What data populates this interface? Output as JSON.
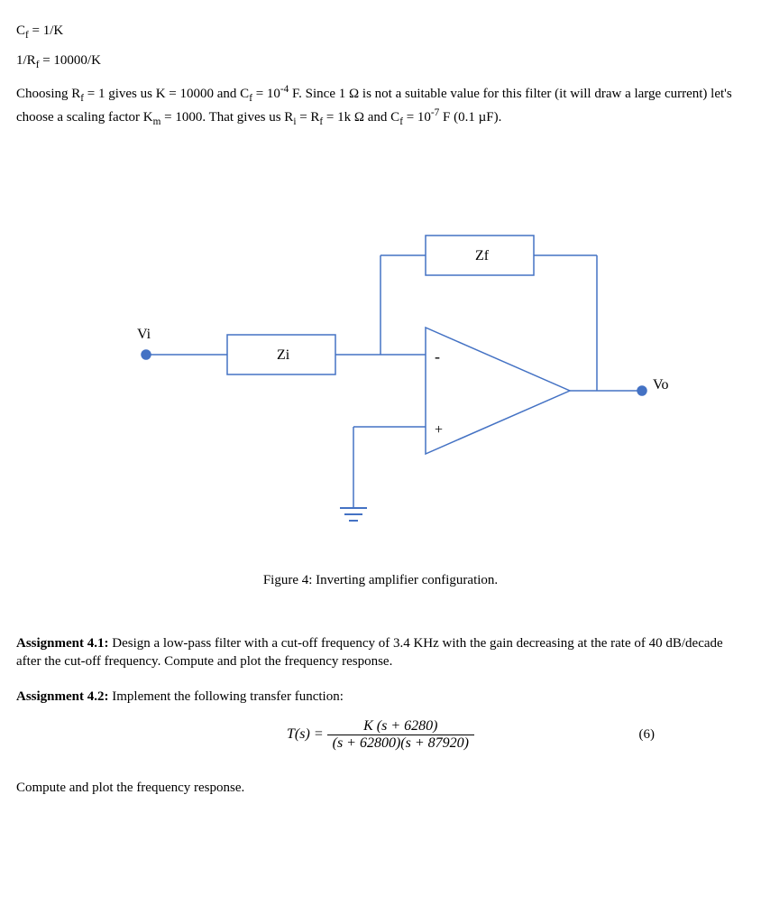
{
  "line1": "Cf = 1/K",
  "line2": "1/Rf = 10000/K",
  "para1": "Choosing Rf = 1 gives us K = 10000 and Cf = 10⁻⁴ F. Since 1 Ω is not a suitable value for this filter (it will draw a large current) let's choose a scaling factor Km = 1000. That gives us Ri = Rf = 1k Ω and Cf = 10⁻⁷ F (0.1 μF).",
  "diagram": {
    "vi": "Vi",
    "zi": "Zi",
    "zf": "Zf",
    "vo": "Vo",
    "minus": "-",
    "plus": "+"
  },
  "caption": "Figure 4: Inverting amplifier configuration.",
  "assign41_label": "Assignment 4.1:",
  "assign41_text": " Design a low-pass filter with a cut-off frequency of 3.4 KHz with the gain decreasing at the rate of 40 dB/decade after the cut-off frequency. Compute and plot the frequency response.",
  "assign42_label": "Assignment 4.2:",
  "assign42_text": " Implement the following transfer function:",
  "eq": {
    "lhs": "T(s) = ",
    "num": "K (s + 6280)",
    "den": "(s + 62800)(s + 87920)",
    "num_label": "(6)"
  },
  "final": "Compute and plot the frequency response."
}
